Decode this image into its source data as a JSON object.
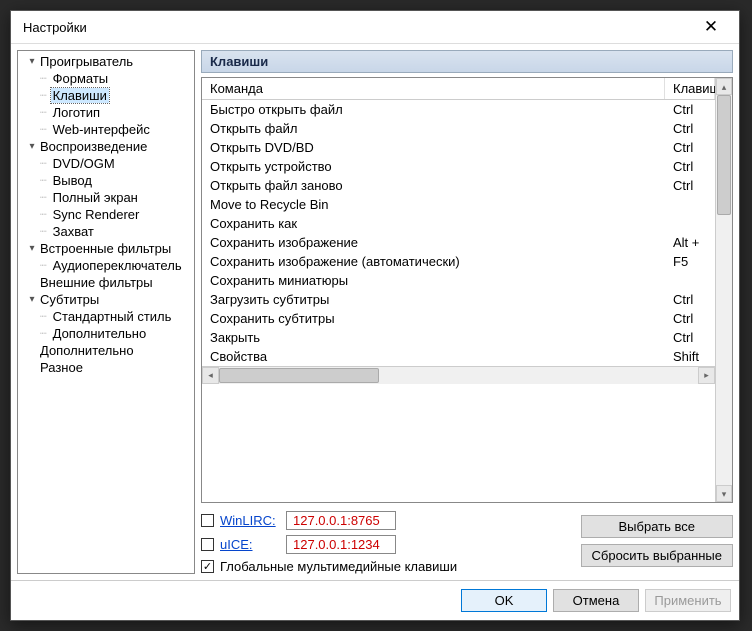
{
  "window": {
    "title": "Настройки"
  },
  "tree": [
    {
      "label": "Проигрыватель",
      "expanded": true,
      "children": [
        {
          "label": "Форматы"
        },
        {
          "label": "Клавиши",
          "selected": true
        },
        {
          "label": "Логотип"
        },
        {
          "label": "Web-интерфейс"
        }
      ]
    },
    {
      "label": "Воспроизведение",
      "expanded": true,
      "children": [
        {
          "label": "DVD/OGM"
        },
        {
          "label": "Вывод"
        },
        {
          "label": "Полный экран"
        },
        {
          "label": "Sync Renderer"
        },
        {
          "label": "Захват"
        }
      ]
    },
    {
      "label": "Встроенные фильтры",
      "expanded": true,
      "children": [
        {
          "label": "Аудиопереключатель"
        }
      ]
    },
    {
      "label": "Внешние фильтры",
      "expanded": false,
      "children": []
    },
    {
      "label": "Субтитры",
      "expanded": true,
      "children": [
        {
          "label": "Стандартный стиль"
        },
        {
          "label": "Дополнительно"
        }
      ]
    },
    {
      "label": "Дополнительно",
      "expanded": false,
      "children": []
    },
    {
      "label": "Разное",
      "expanded": false,
      "children": []
    }
  ],
  "section": {
    "title": "Клавиши"
  },
  "table": {
    "headers": {
      "command": "Команда",
      "key": "Клавиши"
    },
    "rows": [
      {
        "command": "Быстро открыть файл",
        "key": "Ctrl"
      },
      {
        "command": "Открыть файл",
        "key": "Ctrl"
      },
      {
        "command": "Открыть DVD/BD",
        "key": "Ctrl"
      },
      {
        "command": "Открыть устройство",
        "key": "Ctrl"
      },
      {
        "command": "Открыть файл заново",
        "key": "Ctrl"
      },
      {
        "command": "Move to Recycle Bin",
        "key": ""
      },
      {
        "command": "Сохранить как",
        "key": ""
      },
      {
        "command": "Сохранить изображение",
        "key": "Alt +"
      },
      {
        "command": "Сохранить изображение (автоматически)",
        "key": "F5"
      },
      {
        "command": "Сохранить миниатюры",
        "key": ""
      },
      {
        "command": "Загрузить субтитры",
        "key": "Ctrl"
      },
      {
        "command": "Сохранить субтитры",
        "key": "Ctrl"
      },
      {
        "command": "Закрыть",
        "key": "Ctrl"
      },
      {
        "command": "Свойства",
        "key": "Shift"
      }
    ]
  },
  "remote": {
    "winlirc": {
      "label": "WinLIRC:",
      "value": "127.0.0.1:8765",
      "checked": false
    },
    "uice": {
      "label": "uICE:",
      "value": "127.0.0.1:1234",
      "checked": false
    },
    "global": {
      "label": "Глобальные мультимедийные клавиши",
      "checked": true
    }
  },
  "buttons": {
    "select_all": "Выбрать все",
    "reset_selected": "Сбросить выбранные",
    "ok": "OK",
    "cancel": "Отмена",
    "apply": "Применить"
  }
}
